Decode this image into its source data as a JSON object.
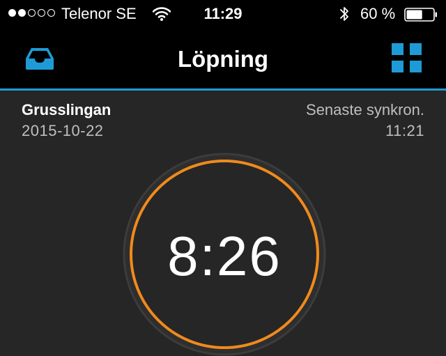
{
  "status_bar": {
    "signal_bars_filled": 2,
    "signal_bars_total": 5,
    "carrier": "Telenor SE",
    "time": "11:29",
    "battery_percent": "60 %",
    "battery_level": 0.6
  },
  "nav": {
    "title": "Löpning",
    "left_icon": "inbox-tray-icon",
    "right_icon": "grid-icon"
  },
  "info": {
    "route_name": "Grusslingan",
    "route_date": "2015-10-22",
    "sync_label": "Senaste synkron.",
    "sync_time": "11:21"
  },
  "timer": {
    "value": "8:26"
  },
  "colors": {
    "accent": "#1e9bd7",
    "ring": "#f08a1c",
    "background": "#262626",
    "header": "#000000"
  }
}
